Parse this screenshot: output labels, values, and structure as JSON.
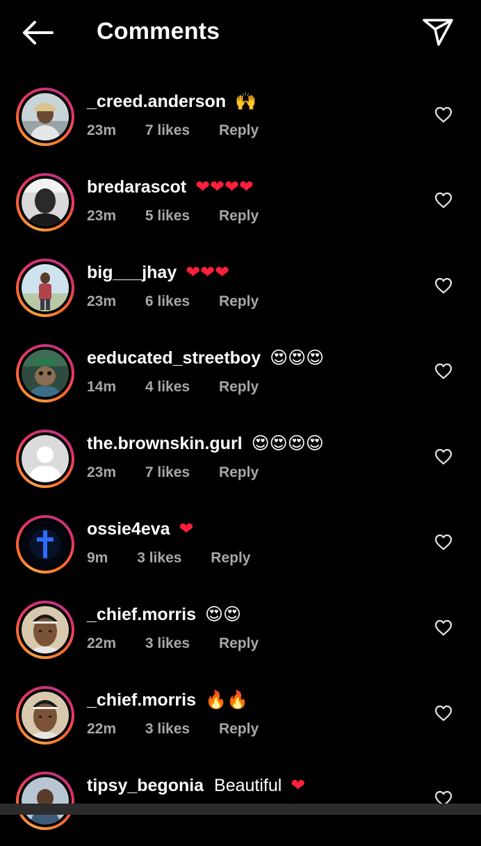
{
  "header": {
    "title": "Comments",
    "back_icon": "arrow-left-icon",
    "share_icon": "paper-plane-icon"
  },
  "colors": {
    "background": "#000000",
    "text": "#ffffff",
    "meta_text": "#a8a8a8",
    "heart": "#ff1f3d",
    "ring_start": "#f9a03f",
    "ring_end": "#c13584"
  },
  "comments": [
    {
      "username": "_creed.anderson",
      "text": "",
      "emoji": "🙌",
      "time": "23m",
      "likes": "7 likes",
      "reply": "Reply",
      "avatar": "person-hat"
    },
    {
      "username": "bredarascot",
      "text": "",
      "emoji": "❤❤❤❤",
      "time": "23m",
      "likes": "5 likes",
      "reply": "Reply",
      "avatar": "person-mono"
    },
    {
      "username": "big___jhay",
      "text": "",
      "emoji": "❤❤❤",
      "time": "23m",
      "likes": "6 likes",
      "reply": "Reply",
      "avatar": "person-outdoor"
    },
    {
      "username": "eeducated_streetboy",
      "text": "",
      "emoji": "😍😍😍",
      "time": "14m",
      "likes": "4 likes",
      "reply": "Reply",
      "avatar": "creature"
    },
    {
      "username": "the.brownskin.gurl",
      "text": "",
      "emoji": "😍😍😍😍",
      "time": "23m",
      "likes": "7 likes",
      "reply": "Reply",
      "avatar": "default"
    },
    {
      "username": "ossie4eva",
      "text": "",
      "emoji": "❤",
      "time": "9m",
      "likes": "3 likes",
      "reply": "Reply",
      "avatar": "cross"
    },
    {
      "username": "_chief.morris",
      "text": "",
      "emoji": "😍😍",
      "time": "22m",
      "likes": "3 likes",
      "reply": "Reply",
      "avatar": "person-face"
    },
    {
      "username": "_chief.morris",
      "text": "",
      "emoji": "🔥🔥",
      "time": "22m",
      "likes": "3 likes",
      "reply": "Reply",
      "avatar": "person-face"
    },
    {
      "username": "tipsy_begonia",
      "text": "Beautiful",
      "emoji": "❤",
      "time": "",
      "likes": "",
      "reply": "",
      "avatar": "person-partial"
    }
  ],
  "like_icon": "heart-outline-icon"
}
